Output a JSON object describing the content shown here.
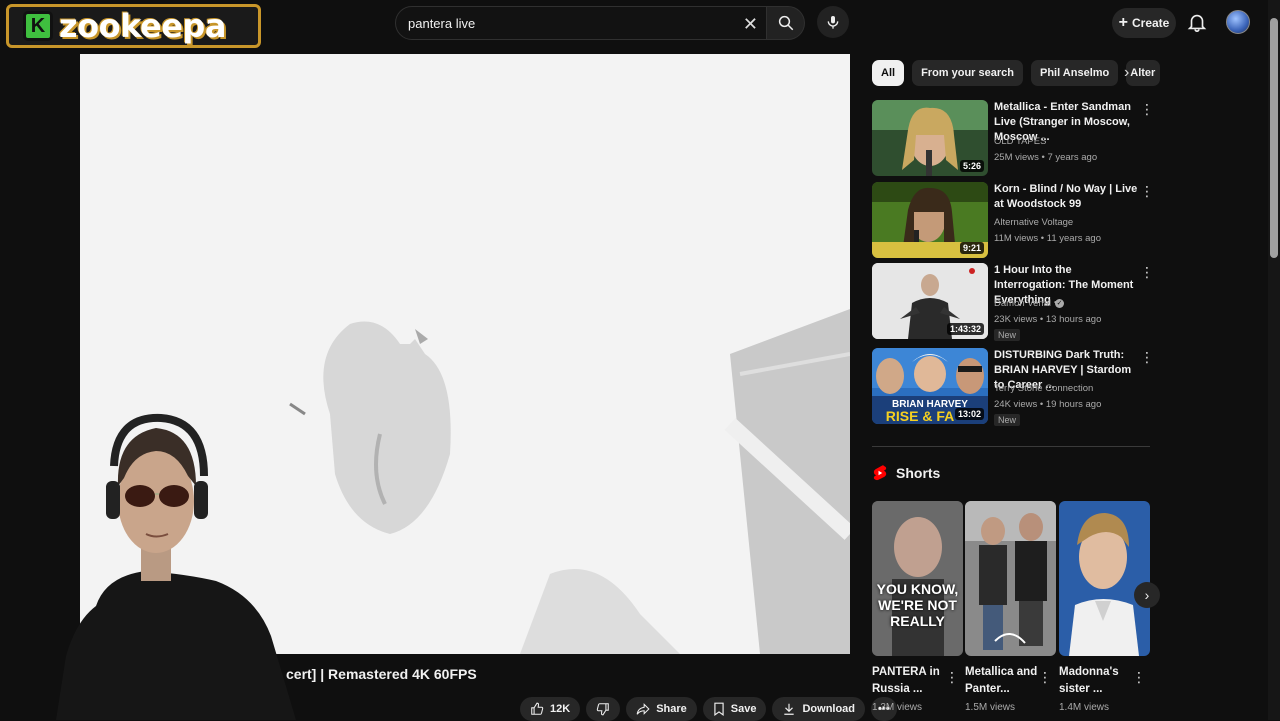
{
  "search": {
    "value": "pantera live"
  },
  "header": {
    "create_label": "Create",
    "logo_text": "zookeepa",
    "logo_badge": "K"
  },
  "video": {
    "title": "cert] | Remastered 4K 60FPS",
    "actions": {
      "like_count": "12K",
      "share_label": "Share",
      "save_label": "Save",
      "download_label": "Download"
    }
  },
  "chips": [
    "All",
    "From your search",
    "Phil Anselmo",
    "Alter"
  ],
  "recommendations": [
    {
      "title": "Metallica - Enter Sandman Live (Stranger in Moscow, Moscow ...",
      "channel": "OLD TAPES",
      "meta": "25M views • 7 years ago",
      "duration": "5:26",
      "thumb_color": "#3a6b3a"
    },
    {
      "title": "Korn - Blind / No Way | Live at Woodstock 99",
      "channel": "Alternative Voltage",
      "meta": "11M views • 11 years ago",
      "duration": "9:21",
      "thumb_color": "#4f7a2a"
    },
    {
      "title": "1 Hour Into the Interrogation: The Moment Everything ...",
      "channel": "Damon Verial",
      "meta": "23K views • 13 hours ago",
      "duration": "1:43:32",
      "badge": "New",
      "thumb_color": "#d8d8d8"
    },
    {
      "title": "DISTURBING Dark Truth: BRIAN HARVEY | Stardom to Career ...",
      "channel": "Terry Stone Connection",
      "meta": "24K views • 19 hours ago",
      "duration": "13:02",
      "badge": "New",
      "thumb_color": "#2b6fc0"
    }
  ],
  "rec4_overlay": {
    "line1": "BRIAN HARVEY",
    "line2": "RISE & FA"
  },
  "shorts": {
    "heading": "Shorts",
    "items": [
      {
        "title": "PANTERA in Russia ...",
        "views": "1.3M views",
        "overlay": "YOU KNOW, WE'RE NOT REALLY"
      },
      {
        "title": "Metallica and Panter...",
        "views": "1.5M views"
      },
      {
        "title": "Madonna's sister ...",
        "views": "1.4M views"
      }
    ]
  },
  "colors": {
    "background": "#0f0f0f",
    "chip_active": "#f1f1f1",
    "logo_accent": "#c8962a",
    "shorts_red": "#ff0000"
  }
}
